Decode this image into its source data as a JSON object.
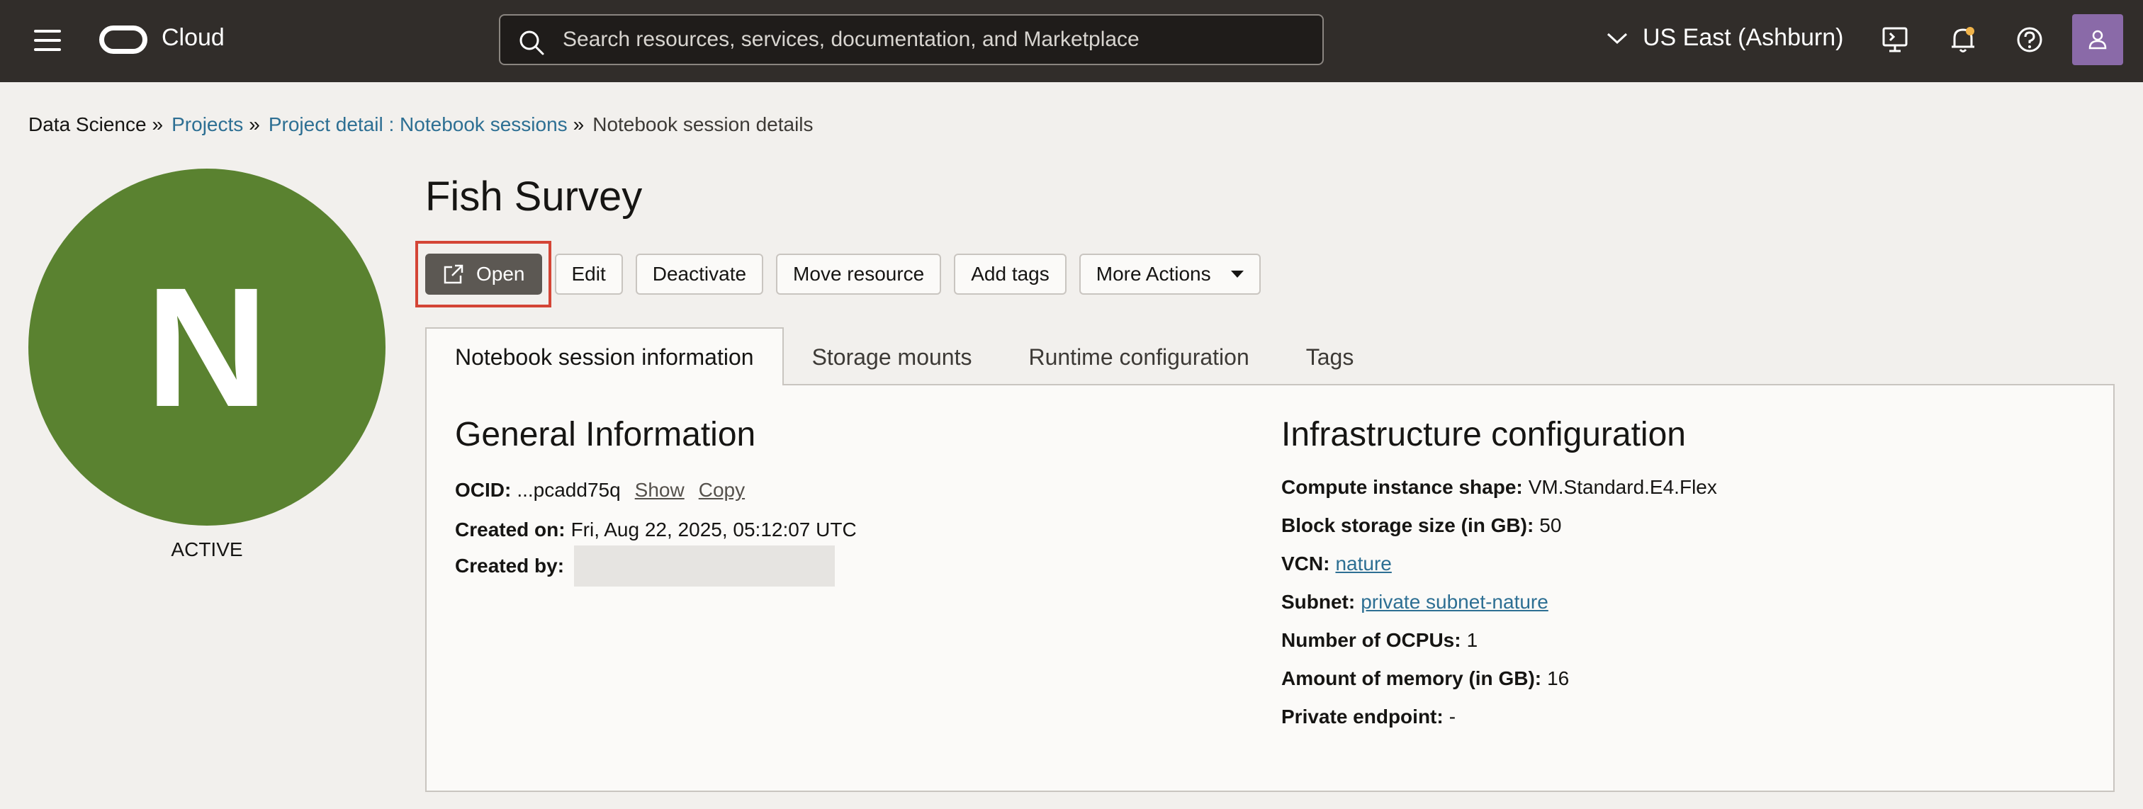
{
  "topbar": {
    "brand": "Cloud",
    "search_placeholder": "Search resources, services, documentation, and Marketplace",
    "region": "US East (Ashburn)",
    "icons": [
      "menu-icon",
      "oracle-logo",
      "search-icon",
      "chevron-down-icon",
      "cloud-shell-icon",
      "bell-icon",
      "help-icon",
      "user-icon"
    ]
  },
  "breadcrumb": {
    "root": "Data Science",
    "projects": "Projects",
    "project_detail": "Project detail : Notebook sessions",
    "current": "Notebook session details",
    "separator": "»"
  },
  "resource": {
    "letter": "N",
    "status": "ACTIVE",
    "badge_color": "#5a8230",
    "title": "Fish Survey"
  },
  "actions": {
    "open": "Open",
    "edit": "Edit",
    "deactivate": "Deactivate",
    "move_resource": "Move resource",
    "add_tags": "Add tags",
    "more_actions": "More Actions"
  },
  "tabs": [
    {
      "label": "Notebook session information"
    },
    {
      "label": "Storage mounts"
    },
    {
      "label": "Runtime configuration"
    },
    {
      "label": "Tags"
    }
  ],
  "general": {
    "title": "General Information",
    "ocid_label": "OCID:",
    "ocid_value": "...pcadd75q",
    "show": "Show",
    "copy": "Copy",
    "created_on_label": "Created on:",
    "created_on_value": "Fri, Aug 22, 2025, 05:12:07 UTC",
    "created_by_label": "Created by:"
  },
  "infra": {
    "title": "Infrastructure configuration",
    "shape_label": "Compute instance shape:",
    "shape_value": "VM.Standard.E4.Flex",
    "storage_label": "Block storage size (in GB):",
    "storage_value": "50",
    "vcn_label": "VCN:",
    "vcn_value": "nature",
    "subnet_label": "Subnet:",
    "subnet_value": "private subnet-nature",
    "ocpus_label": "Number of OCPUs:",
    "ocpus_value": "1",
    "memory_label": "Amount of memory (in GB):",
    "memory_value": "16",
    "endpoint_label": "Private endpoint:",
    "endpoint_value": "-"
  }
}
